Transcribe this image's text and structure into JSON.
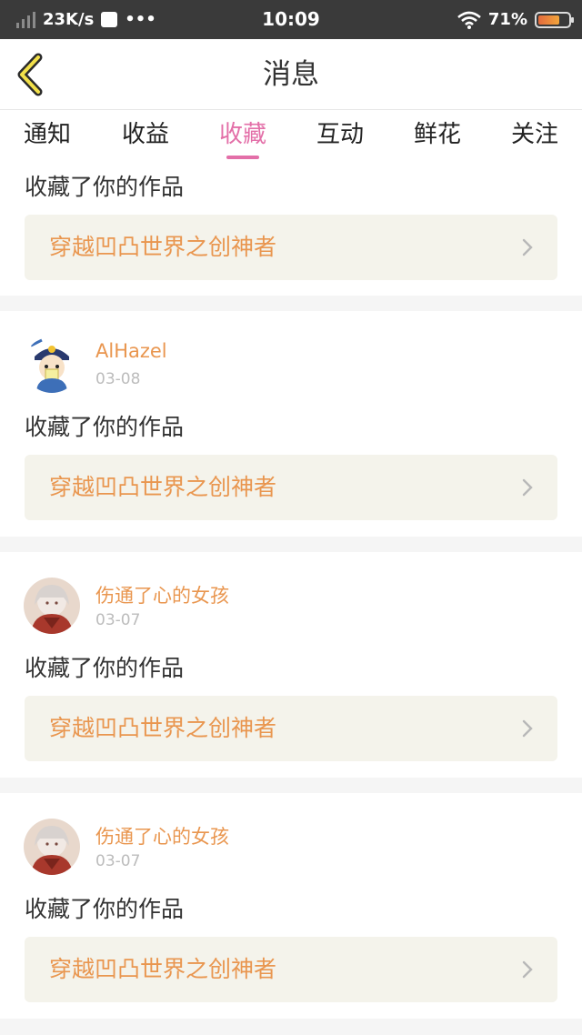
{
  "status_bar": {
    "speed": "23K/s",
    "dots": "•••",
    "time": "10:09",
    "battery_pct_text": "71%",
    "battery_level": 0.71
  },
  "header": {
    "title": "消息",
    "back_icon": "chevron-left-icon"
  },
  "tabs": [
    {
      "label": "通知",
      "active": false
    },
    {
      "label": "收益",
      "active": false
    },
    {
      "label": "收藏",
      "active": true
    },
    {
      "label": "互动",
      "active": false
    },
    {
      "label": "鲜花",
      "active": false
    },
    {
      "label": "关注",
      "active": false
    }
  ],
  "accent_color": "#e36fa8",
  "name_color": "#e9964f",
  "feed": {
    "partial": {
      "action": "收藏了你的作品",
      "work_title": "穿越凹凸世界之创神者"
    },
    "items": [
      {
        "username": "AlHazel",
        "date": "03-08",
        "avatar": "cartoon-avatar",
        "action": "收藏了你的作品",
        "work_title": "穿越凹凸世界之创神者"
      },
      {
        "username": "伤通了心的女孩",
        "date": "03-07",
        "avatar": "anime-girl-avatar",
        "action": "收藏了你的作品",
        "work_title": "穿越凹凸世界之创神者"
      },
      {
        "username": "伤通了心的女孩",
        "date": "03-07",
        "avatar": "anime-girl-avatar",
        "action": "收藏了你的作品",
        "work_title": "穿越凹凸世界之创神者"
      }
    ]
  }
}
